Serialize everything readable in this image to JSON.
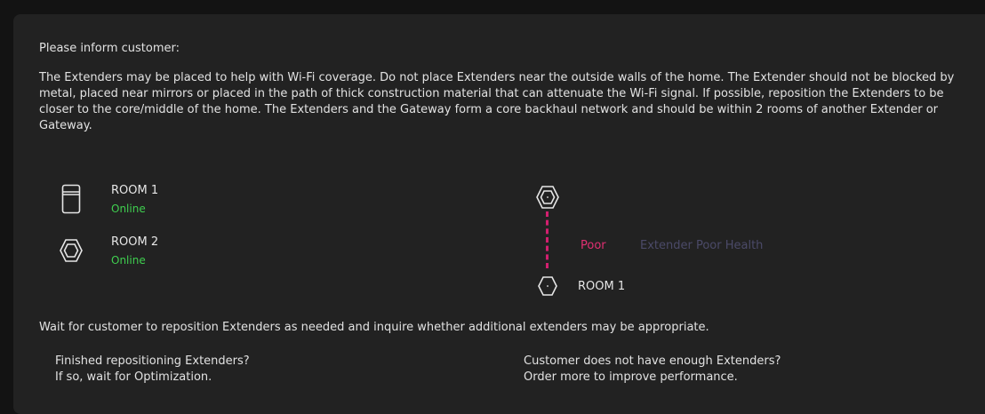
{
  "intro": "Please inform customer:",
  "paragraph": "The Extenders may be placed to help with Wi-Fi coverage. Do not place Extenders near the outside walls of the home. The Extender should not be blocked by metal, placed near mirrors or placed in the path of thick construction material that can attenuate the Wi-Fi signal. If possible, reposition the Extenders to be closer to the core/middle of the home. The Extenders and the Gateway form a core backhaul network and should be within 2 rooms of another Extender or Gateway.",
  "devices": [
    {
      "room": "ROOM 1",
      "status": "Online",
      "icon": "gateway-icon"
    },
    {
      "room": "ROOM 2",
      "status": "Online",
      "icon": "extender-hexagon-icon"
    }
  ],
  "connection": {
    "quality": "Poor",
    "health_text": "Extender Poor Health",
    "target_room": "ROOM 1",
    "line_color": "#d21f6e"
  },
  "wait_text": "Wait for customer to reposition Extenders as needed and inquire whether additional extenders may be appropriate.",
  "actions": {
    "finished": {
      "line1": "Finished repositioning Extenders?",
      "line2": "If so, wait for Optimization."
    },
    "not_enough": {
      "line1": "Customer does not have enough Extenders?",
      "line2": "Order more to improve performance."
    }
  },
  "colors": {
    "online": "#3fcf4f",
    "poor": "#e02f72",
    "health": "#4b4a68"
  }
}
